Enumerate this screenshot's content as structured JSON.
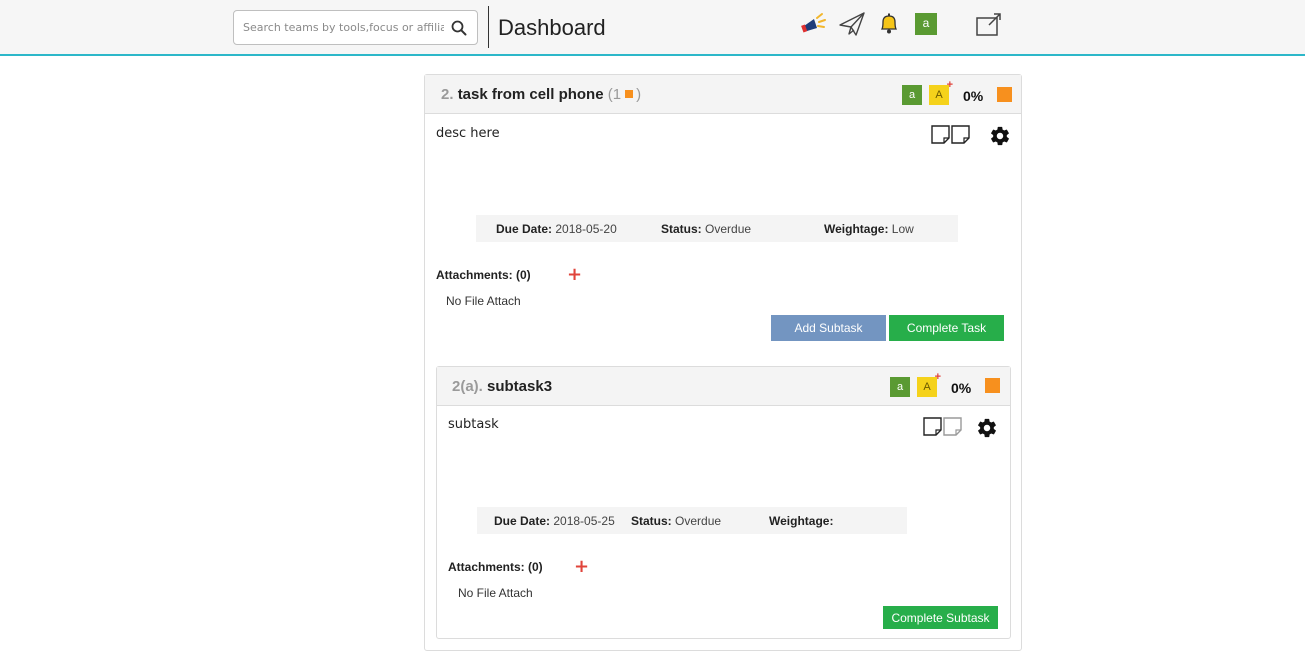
{
  "header": {
    "search_placeholder": "Search teams by tools,focus or affiliation",
    "title": "Dashboard",
    "avatar_initial": "a",
    "icons": [
      "megaphone-icon",
      "paper-plane-icon",
      "bell-icon",
      "external-link-icon",
      "search-icon"
    ]
  },
  "task": {
    "number": "2.",
    "name": "task from cell phone",
    "count_open": "(1",
    "count_close": ")",
    "assignee_initial": "a",
    "add_assignee_initial": "A",
    "progress": "0%",
    "description": "desc here",
    "due_label": "Due Date:",
    "due_value": "2018-05-20",
    "status_label": "Status:",
    "status_value": "Overdue",
    "weight_label": "Weightage:",
    "weight_value": "Low",
    "attachments_label": "Attachments: (0)",
    "no_file": "No File Attach",
    "add_subtask_label": "Add Subtask",
    "complete_label": "Complete Task"
  },
  "subtask": {
    "number": "2(a).",
    "name": "subtask3",
    "assignee_initial": "a",
    "add_assignee_initial": "A",
    "progress": "0%",
    "description": "subtask",
    "due_label": "Due Date:",
    "due_value": "2018-05-25",
    "status_label": "Status:",
    "status_value": "Overdue",
    "weight_label": "Weightage:",
    "weight_value": "",
    "attachments_label": "Attachments: (0)",
    "no_file": "No File Attach",
    "complete_label": "Complete Subtask"
  },
  "colors": {
    "accent_line": "#2cb7c9",
    "avatar_green": "#5a9a32",
    "status_orange": "#f7901e",
    "button_blue": "#7395c1",
    "button_green": "#27ae4a",
    "plus_red": "#e0443b"
  }
}
